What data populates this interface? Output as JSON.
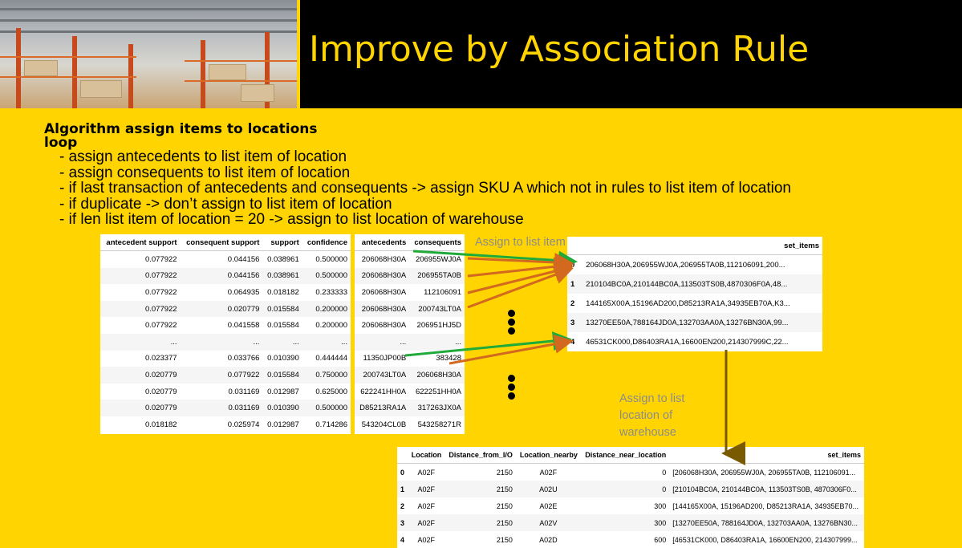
{
  "title": "Improve by Association Rule",
  "algorithm": {
    "heading": "Algorithm assign items to locations",
    "loop": "loop",
    "steps": [
      "- assign antecedents to list item of location",
      "- assign consequents to list item of location",
      "- if last transaction of antecedents and consequents -> assign SKU A which not in rules to list item of location",
      "- if duplicate -> don’t assign to list item of location",
      "- if len list item of location = 20 -> assign to list location of warehouse"
    ]
  },
  "rules_table": {
    "headers": [
      "antecedent support",
      "consequent support",
      "support",
      "confidence"
    ],
    "rows": [
      [
        "0.077922",
        "0.044156",
        "0.038961",
        "0.500000"
      ],
      [
        "0.077922",
        "0.044156",
        "0.038961",
        "0.500000"
      ],
      [
        "0.077922",
        "0.064935",
        "0.018182",
        "0.233333"
      ],
      [
        "0.077922",
        "0.020779",
        "0.015584",
        "0.200000"
      ],
      [
        "0.077922",
        "0.041558",
        "0.015584",
        "0.200000"
      ],
      [
        "...",
        "...",
        "...",
        "..."
      ],
      [
        "0.023377",
        "0.033766",
        "0.010390",
        "0.444444"
      ],
      [
        "0.020779",
        "0.077922",
        "0.015584",
        "0.750000"
      ],
      [
        "0.020779",
        "0.031169",
        "0.012987",
        "0.625000"
      ],
      [
        "0.020779",
        "0.031169",
        "0.010390",
        "0.500000"
      ],
      [
        "0.018182",
        "0.025974",
        "0.012987",
        "0.714286"
      ]
    ]
  },
  "ante_cons_table": {
    "headers": [
      "antecedents",
      "consequents"
    ],
    "rows": [
      [
        "206068H30A",
        "206955WJ0A"
      ],
      [
        "206068H30A",
        "206955TA0B"
      ],
      [
        "206068H30A",
        "112106091"
      ],
      [
        "206068H30A",
        "200743LT0A"
      ],
      [
        "206068H30A",
        "206951HJ5D"
      ],
      [
        "...",
        "..."
      ],
      [
        "11350JP00B",
        "383428"
      ],
      [
        "200743LT0A",
        "206068H30A"
      ],
      [
        "622241HH0A",
        "622251HH0A"
      ],
      [
        "D85213RA1A",
        "317263JX0A"
      ],
      [
        "543204CL0B",
        "543258271R"
      ]
    ]
  },
  "label_assign_items": "Assign to list item of location",
  "set_items_table": {
    "header": "set_items",
    "rows": [
      [
        "0",
        "206068H30A,206955WJ0A,206955TA0B,112106091,200..."
      ],
      [
        "1",
        "210104BC0A,210144BC0A,113503TS0B,4870306F0A,48..."
      ],
      [
        "2",
        "144165X00A,15196AD200,D85213RA1A,34935EB70A,K3..."
      ],
      [
        "3",
        "13270EE50A,788164JD0A,132703AA0A,13276BN30A,99..."
      ],
      [
        "4",
        "46531CK000,D86403RA1A,16600EN200,214307999C,22..."
      ]
    ]
  },
  "label_assign_warehouse": "Assign to list location of warehouse",
  "warehouse_table": {
    "headers": [
      "",
      "Location",
      "Distance_from_I/O",
      "Location_nearby",
      "Distance_near_location",
      "set_items"
    ],
    "rows": [
      [
        "0",
        "A02F",
        "2150",
        "A02F",
        "0",
        "[206068H30A, 206955WJ0A, 206955TA0B, 112106091..."
      ],
      [
        "1",
        "A02F",
        "2150",
        "A02U",
        "0",
        "[210104BC0A, 210144BC0A, 113503TS0B, 4870306F0..."
      ],
      [
        "2",
        "A02F",
        "2150",
        "A02E",
        "300",
        "[144165X00A, 15196AD200, D85213RA1A, 34935EB70..."
      ],
      [
        "3",
        "A02F",
        "2150",
        "A02V",
        "300",
        "[13270EE50A, 788164JD0A, 132703AA0A, 13276BN30..."
      ],
      [
        "4",
        "A02F",
        "2150",
        "A02D",
        "600",
        "[46531CK000, D86403RA1A, 16600EN200, 214307999..."
      ]
    ]
  },
  "colors": {
    "background": "#ffd400",
    "header": "#000000",
    "title": "#ffd400",
    "arrow_green": "#1faa3a",
    "arrow_orange": "#d2691e",
    "arrow_down": "#7a5a00"
  }
}
